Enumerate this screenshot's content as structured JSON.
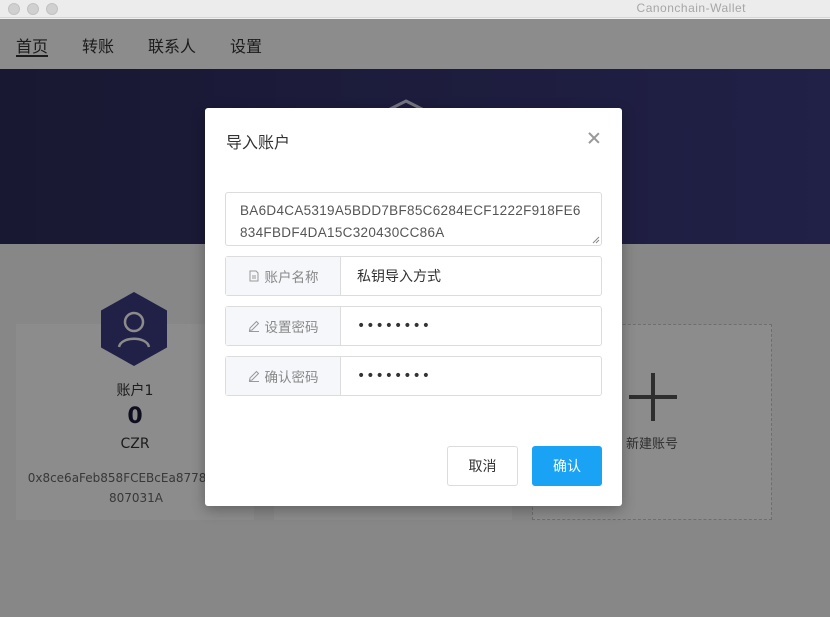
{
  "window": {
    "title": "Canonchain-Wallet"
  },
  "nav": {
    "items": [
      {
        "label": "首页",
        "active": true
      },
      {
        "label": "转账"
      },
      {
        "label": "联系人"
      },
      {
        "label": "设置"
      }
    ]
  },
  "accounts": [
    {
      "name": "账户1",
      "balance": "0",
      "unit": "CZR",
      "address": "0x8ce6aFeb858FCEBcEa8778eC89F807031A"
    }
  ],
  "add_account": {
    "label": "新建账号"
  },
  "modal": {
    "title": "导入账户",
    "private_key": "BA6D4CA5319A5BDD7BF85C6284ECF1222F918FE6834FBDF4DA15C320430CC86A",
    "fields": [
      {
        "label": "账户名称",
        "value": "私钥导入方式",
        "icon": "document-icon"
      },
      {
        "label": "设置密码",
        "value": "••••••••",
        "icon": "pencil-icon"
      },
      {
        "label": "确认密码",
        "value": "••••••••",
        "icon": "pencil-icon"
      }
    ],
    "cancel_label": "取消",
    "confirm_label": "确认"
  },
  "colors": {
    "banner": "#2e2d5c",
    "accent": "#1aa3f5",
    "avatar": "#3c3b82"
  }
}
